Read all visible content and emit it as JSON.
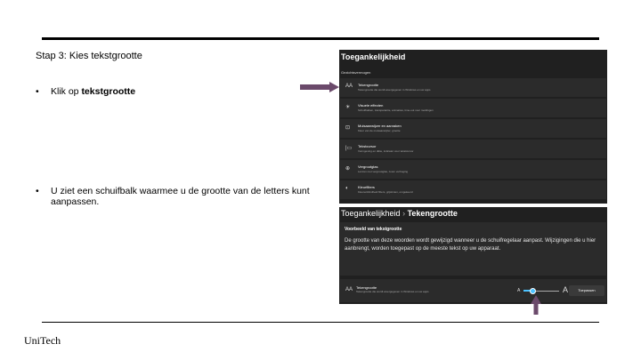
{
  "slide": {
    "step_title": "Stap 3: Kies tekstgrootte",
    "bullet1_prefix": "Klik op ",
    "bullet1_bold": "tekstgrootte",
    "bullet2": "U ziet een schuifbalk waarmee u de grootte van de letters kunt aanpassen.",
    "bullet_symbol": "•",
    "footer": "UniTech",
    "arrow_color": "#6b4a6b"
  },
  "panel1": {
    "title": "Toegankelijkheid",
    "section": "Gezichtsvermogen",
    "items": [
      {
        "icon": "AA",
        "label": "Tekengrootte",
        "sub": "Tekengrootte die wordt weergegeven in Windows en uw apps"
      },
      {
        "icon": "☀",
        "label": "Visuele effecten",
        "sub": "Schuifbalken, transparantie, animaties, time-out voor meldingen"
      },
      {
        "icon": "⊡",
        "label": "Muisaanwijzer en aanraken",
        "sub": "Kleur van de muisaanwijzer, grootte"
      },
      {
        "icon": "|▭",
        "label": "Tekstcursor",
        "sub": "Vormgeving en dikte, indicator voor tekstcursor"
      },
      {
        "icon": "⊕",
        "label": "Vergrootglas",
        "sub": "Lenzen met vergrootglas, zoom verhoging"
      },
      {
        "icon": "◐",
        "label": "Kleurfilters",
        "sub": "Kleurenblindheid filters, grijstinten, omgekeerd"
      }
    ]
  },
  "panel2": {
    "breadcrumb_parent": "Toegankelijkheid",
    "breadcrumb_sep": "›",
    "breadcrumb_current": "Tekengrootte",
    "preview_title": "Voorbeeld van tekstgrootte",
    "preview_text": "De grootte van deze woorden wordt gewijzigd wanneer u de schuifregelaar aanpast. Wijzigingen die u hier aanbrengt, worden toegepast op de meeste tekst op uw apparaat.",
    "row_icon": "AA",
    "row_label": "Tekengrootte",
    "row_sub": "Tekengrootte die wordt weergegeven in Windows en uw apps",
    "slider_small": "A",
    "slider_big": "A",
    "slider_value": 0.25,
    "apply_label": "Toepassen",
    "accent": "#4cc2ff"
  }
}
